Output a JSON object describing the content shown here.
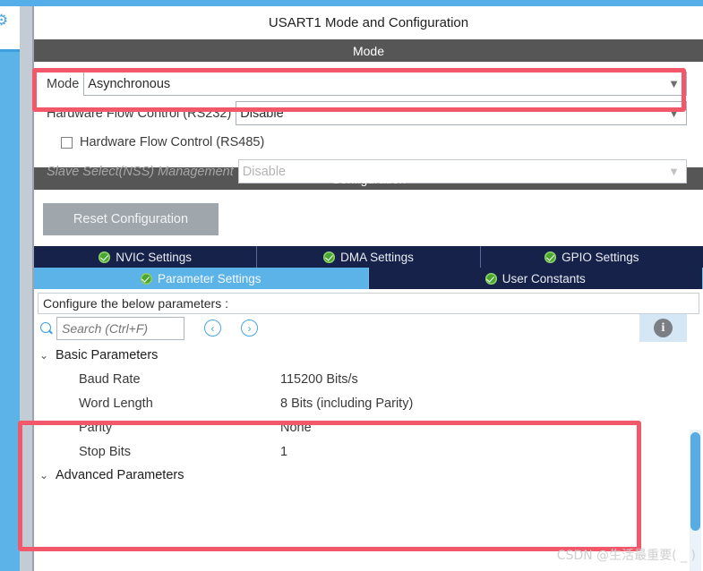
{
  "window": {
    "title": "USART1 Mode and Configuration"
  },
  "mode_section": {
    "header": "Mode",
    "rows": [
      {
        "label": "Mode",
        "value": "Asynchronous",
        "icon": "chevron-down-icon",
        "disabled": false
      },
      {
        "label": "Hardware Flow Control (RS232)",
        "value": "Disable",
        "icon": "chevron-down-icon",
        "disabled": false
      }
    ],
    "checkbox": {
      "label": "Hardware Flow Control (RS485)",
      "checked": false
    },
    "slave_select": {
      "label": "Slave Select(NSS) Management",
      "value": "Disable",
      "icon": "chevron-down-icon",
      "disabled": true
    }
  },
  "config_section": {
    "header": "Configuration",
    "reset_button": "Reset Configuration",
    "tabs_row1": [
      {
        "label": "NVIC Settings",
        "icon": "check-circle-icon",
        "active": false
      },
      {
        "label": "DMA Settings",
        "icon": "check-circle-icon",
        "active": false
      },
      {
        "label": "GPIO Settings",
        "icon": "check-circle-icon",
        "active": false
      }
    ],
    "tabs_row2": [
      {
        "label": "Parameter Settings",
        "icon": "check-circle-icon",
        "active": true
      },
      {
        "label": "User Constants",
        "icon": "check-circle-icon",
        "active": false
      }
    ],
    "configure_hint": "Configure the below parameters :",
    "search": {
      "placeholder": "Search (Ctrl+F)",
      "value": "",
      "icon": "search-icon",
      "prev_icon": "chevron-left-icon",
      "prev_label": "‹",
      "next_icon": "chevron-right-icon",
      "next_label": "›",
      "info_icon": "info-icon",
      "info_label": "i"
    }
  },
  "parameters": {
    "basic": {
      "group_label": "Basic Parameters",
      "caret": "⌄",
      "rows": [
        {
          "name": "Baud Rate",
          "value": "115200 Bits/s"
        },
        {
          "name": "Word Length",
          "value": "8 Bits (including Parity)"
        },
        {
          "name": "Parity",
          "value": "None"
        },
        {
          "name": "Stop Bits",
          "value": "1"
        }
      ]
    },
    "advanced": {
      "group_label": "Advanced Parameters",
      "caret": "⌄"
    }
  },
  "watermark": "CSDN @生活最重要(  _  )",
  "colors": {
    "header_bar": "#565656",
    "tab_inactive": "#16224a",
    "tab_active": "#5cb3e8",
    "accent_blue": "#55aee8",
    "annotation_red": "#f2586a",
    "check_green": "#4aa72e"
  }
}
